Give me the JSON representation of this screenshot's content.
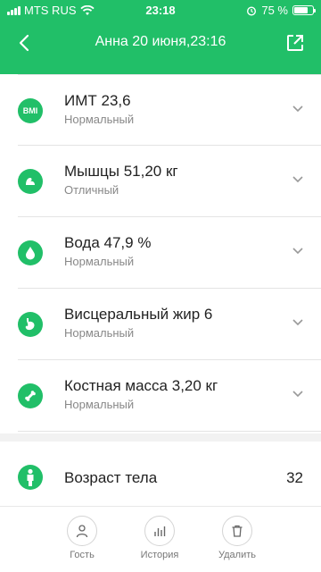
{
  "status": {
    "carrier": "MTS RUS",
    "time": "23:18",
    "battery": "75 %",
    "battery_level": 0.75
  },
  "header": {
    "title": "Анна 20 июня,23:16"
  },
  "metrics": [
    {
      "icon": "bmi-icon",
      "icon_text": "BMI",
      "name": "ИМТ 23,6",
      "status": "Нормальный"
    },
    {
      "icon": "muscle-icon",
      "name": "Мышцы 51,20 кг",
      "status": "Отличный"
    },
    {
      "icon": "water-drop-icon",
      "name": "Вода 47,9 %",
      "status": "Нормальный"
    },
    {
      "icon": "stomach-icon",
      "name": "Висцеральный жир 6",
      "status": "Нормальный"
    },
    {
      "icon": "bone-icon",
      "name": "Костная масса 3,20 кг",
      "status": "Нормальный"
    }
  ],
  "body_age": {
    "label": "Возраст тела",
    "value": "32"
  },
  "tabs": [
    {
      "icon": "person-icon",
      "label": "Гость"
    },
    {
      "icon": "bar-chart-icon",
      "label": "История"
    },
    {
      "icon": "trash-icon",
      "label": "Удалить"
    }
  ],
  "colors": {
    "accent": "#21bf68"
  }
}
